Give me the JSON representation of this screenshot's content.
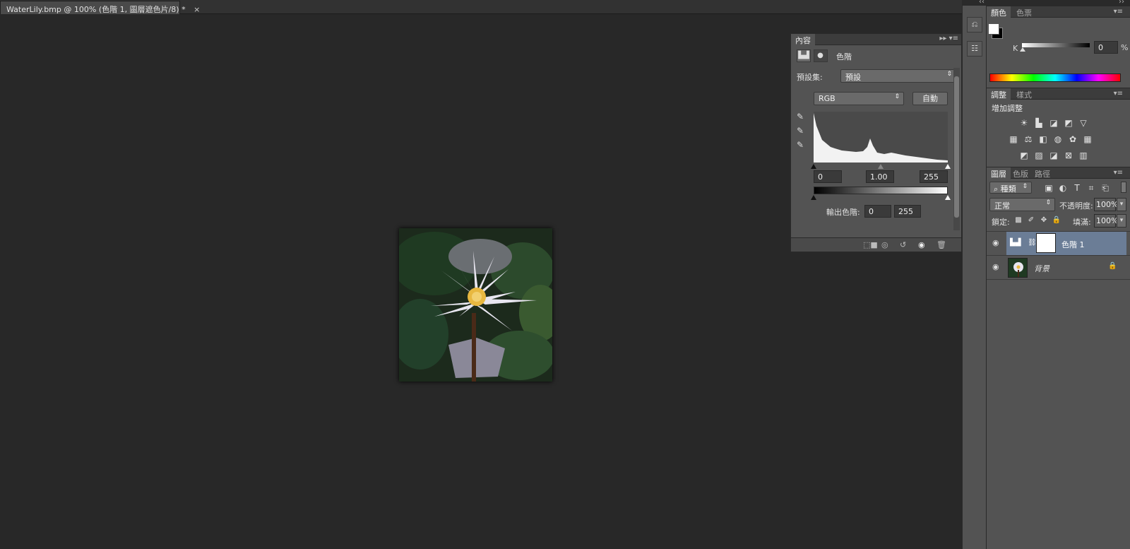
{
  "document": {
    "tab_title": "WaterLily.bmp @ 100% (色階 1, 圖層遮色片/8) *",
    "close_glyph": "×"
  },
  "properties_panel": {
    "tab_label": "內容",
    "panel_title": "色階",
    "preset_label": "預設集:",
    "preset_value": "預設",
    "channel_value": "RGB",
    "auto_button": "自動",
    "input_black": "0",
    "input_gamma": "1.00",
    "input_white": "255",
    "output_label": "輸出色階:",
    "output_black": "0",
    "output_white": "255"
  },
  "color_panel": {
    "tabs": [
      "顏色",
      "色票"
    ],
    "channel_label": "K",
    "value": "0",
    "unit": "%"
  },
  "adjustments_panel": {
    "tabs": [
      "調整",
      "樣式"
    ],
    "heading": "增加調整"
  },
  "layers_panel": {
    "tabs": [
      "圖層",
      "色版",
      "路徑"
    ],
    "filter_label": "種類",
    "blend_mode": "正常",
    "opacity_label": "不透明度:",
    "opacity_value": "100%",
    "lock_label": "鎖定:",
    "fill_label": "填滿:",
    "fill_value": "100%",
    "layers": [
      {
        "name": "色階 1",
        "selected": true
      },
      {
        "name": "背景",
        "selected": false
      }
    ]
  },
  "colors": {
    "selected_layer_bg": "#6b7d96",
    "panel_bg": "#535353",
    "canvas_bg": "#282828"
  }
}
